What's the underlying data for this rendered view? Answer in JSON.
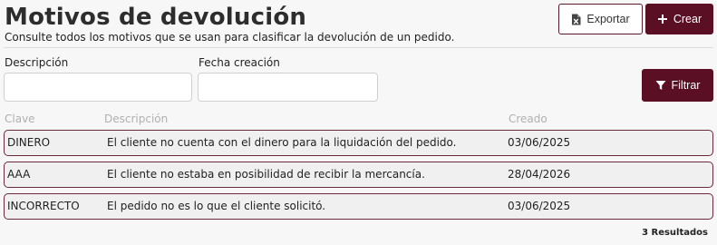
{
  "header": {
    "title": "Motivos de devolución",
    "subtitle": "Consulte todos los motivos que se usan para clasificar la devolución de un pedido.",
    "export_label": "Exportar",
    "create_label": "Crear"
  },
  "filters": {
    "description_label": "Descripción",
    "description_value": "",
    "date_label": "Fecha creación",
    "date_value": "",
    "filter_label": "Filtrar"
  },
  "table": {
    "columns": [
      "Clave",
      "Descripción",
      "Creado"
    ],
    "rows": [
      {
        "clave": "DINERO",
        "descripcion": "El cliente no cuenta con el dinero para la liquidación del pedido.",
        "creado": "03/06/2025"
      },
      {
        "clave": "AAA",
        "descripcion": "El cliente no estaba en posibilidad de recibir la mercancía.",
        "creado": "28/04/2026"
      },
      {
        "clave": "INCORRECTO",
        "descripcion": "El pedido no es lo que el cliente solicitó.",
        "creado": "03/06/2025"
      }
    ],
    "results_text": "3 Resultados"
  },
  "colors": {
    "brand": "#5a0f24",
    "row_border": "#6b2a3a",
    "header_text": "#b0b0b0"
  },
  "icons": {
    "export": "excel-file-icon",
    "create": "plus-icon",
    "filter": "funnel-icon"
  }
}
